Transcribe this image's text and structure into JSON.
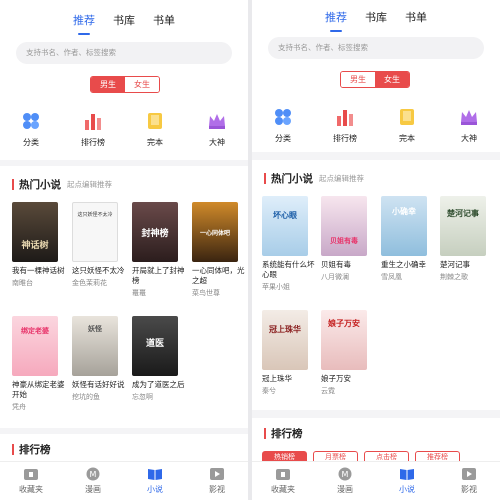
{
  "screens": [
    {
      "tabs": [
        "推荐",
        "书库",
        "书单"
      ],
      "search_placeholder": "支持书名、作者、标签搜索",
      "gender": [
        "男生",
        "女生"
      ],
      "categories": [
        "分类",
        "排行榜",
        "完本",
        "大神"
      ],
      "hot_title": "热门小说",
      "hot_sub": "起点编辑推荐",
      "books": [
        {
          "title": "我有一棵神话树",
          "author": "南睢台",
          "cover_text": "神话树"
        },
        {
          "title": "这只妖怪不太冷",
          "author": "金色茉莉花",
          "cover_text": "这只妖怪不太冷"
        },
        {
          "title": "开局就上了封神榜",
          "author": "鼍鼍",
          "cover_text": "封神榜"
        },
        {
          "title": "一心同体吧，光之超",
          "author": "菜鸟世尊",
          "cover_text": "一心同体吧"
        },
        {
          "title": "神豪从绑定老婆开始",
          "author": "凭舟",
          "cover_text": "绑定老婆"
        },
        {
          "title": "妖怪有话好好说",
          "author": "挖坑的鱼",
          "cover_text": "妖怪"
        },
        {
          "title": "成为了道医之后",
          "author": "忘忽啊",
          "cover_text": "道医"
        }
      ],
      "rank_title": "排行榜",
      "nav": [
        "收藏夹",
        "漫画",
        "小说",
        "影视"
      ]
    },
    {
      "tabs": [
        "推荐",
        "书库",
        "书单"
      ],
      "search_placeholder": "支持书名、作者、标签搜索",
      "gender": [
        "男生",
        "女生"
      ],
      "categories": [
        "分类",
        "排行榜",
        "完本",
        "大神"
      ],
      "hot_title": "热门小说",
      "hot_sub": "起点编辑推荐",
      "books": [
        {
          "title": "系统能有什么坏心眼",
          "author": "苹果小姐",
          "cover_text": "坏心眼"
        },
        {
          "title": "贝姐有毒",
          "author": "八月微澜",
          "cover_text": "贝姐有毒"
        },
        {
          "title": "重生之小确幸",
          "author": "雪凤凰",
          "cover_text": "小确幸"
        },
        {
          "title": "楚河记事",
          "author": "荆棘之歌",
          "cover_text": "楚河记事"
        },
        {
          "title": "冠上珠华",
          "author": "秦兮",
          "cover_text": "冠上珠华"
        },
        {
          "title": "娘子万安",
          "author": "云霓",
          "cover_text": "娘子万安"
        }
      ],
      "rank_title": "排行榜",
      "rank_tabs": [
        "热销榜",
        "月票榜",
        "点击榜",
        "推荐榜"
      ],
      "nav": [
        "收藏夹",
        "漫画",
        "小说",
        "影视"
      ]
    }
  ]
}
